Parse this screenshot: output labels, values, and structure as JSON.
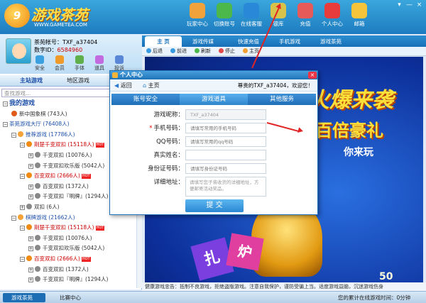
{
  "app": {
    "logo_badge": "9",
    "logo_text": "游戏茶苑",
    "logo_url": "WWW.GAMETEA.COM",
    "window_controls": [
      "▾",
      "—",
      "×"
    ],
    "top_buttons": [
      {
        "label": "玩家中心",
        "icon": "user-center-icon",
        "color": "#f2a23a"
      },
      {
        "label": "切换账号",
        "icon": "switch-account-icon",
        "color": "#4cb84c"
      },
      {
        "label": "在线客服",
        "icon": "support-icon",
        "color": "#2a88d8"
      },
      {
        "label": "银库",
        "icon": "bank-icon",
        "color": "#d8c34a"
      },
      {
        "label": "充值",
        "icon": "recharge-icon",
        "color": "#e65a5a"
      },
      {
        "label": "个人中心",
        "icon": "personal-center-icon",
        "color": "#e83c3c"
      },
      {
        "label": "邮箱",
        "icon": "mail-icon",
        "color": "#f6c43a"
      }
    ]
  },
  "user": {
    "account_label": "茶苑帐号：",
    "account": "TXF_a37404",
    "number_label": "数字ID：",
    "number": "6584960",
    "icons": [
      {
        "label": "安全",
        "icon": "shield-icon",
        "color": "#3aa0e0"
      },
      {
        "label": "会员",
        "icon": "vip-icon",
        "color": "#f09a2a"
      },
      {
        "label": "手体",
        "icon": "phone-icon",
        "color": "#5fb04a"
      },
      {
        "label": "道具",
        "icon": "props-icon",
        "color": "#c46ae0"
      },
      {
        "label": "投诉反馈",
        "icon": "feedback-icon",
        "color": "#5a86d8"
      }
    ]
  },
  "left_tabs": [
    "主站游戏",
    "地区游戏"
  ],
  "search": {
    "placeholder": "查找游戏..."
  },
  "tree": [
    {
      "text": "我的游戏",
      "level": 0,
      "type": "root",
      "color": "#1b4fa8",
      "bold": true
    },
    {
      "text": "新中国象棋 (743人)",
      "level": 1,
      "type": "game",
      "color": "#333"
    },
    {
      "text": "茶苑游戏大厅 (76408人)",
      "level": 0,
      "type": "root",
      "color": "#1b4fa8"
    },
    {
      "text": "推荐游戏 (17786人)",
      "level": 1,
      "type": "folder",
      "color": "#1b4fa8"
    },
    {
      "text": "荆楚千变双扣 (15118人)",
      "level": 2,
      "type": "hot",
      "color": "#c00",
      "badge": "HOT"
    },
    {
      "text": "千变双扣 (10076人)",
      "level": 3,
      "type": "room",
      "color": "#333"
    },
    {
      "text": "千变双扣欢乐版 (5042人)",
      "level": 3,
      "type": "room",
      "color": "#333"
    },
    {
      "text": "百变双扣 (2666人)",
      "level": 2,
      "type": "hot",
      "color": "#c00",
      "badge": "HOT"
    },
    {
      "text": "百变双扣 (1372人)",
      "level": 3,
      "type": "room",
      "color": "#333"
    },
    {
      "text": "千变双扣『明牌』(1294人)",
      "level": 3,
      "type": "room",
      "color": "#333"
    },
    {
      "text": "双扣 (6人)",
      "level": 2,
      "type": "room",
      "color": "#333"
    },
    {
      "text": "棋牌游戏 (21662人)",
      "level": 1,
      "type": "folder",
      "color": "#1b4fa8"
    },
    {
      "text": "荆楚千变双扣 (15118人)",
      "level": 2,
      "type": "hot",
      "color": "#c00",
      "badge": "HOT"
    },
    {
      "text": "千变双扣 (10076人)",
      "level": 3,
      "type": "room",
      "color": "#333"
    },
    {
      "text": "千变双扣欢乐版 (5042人)",
      "level": 3,
      "type": "room",
      "color": "#333"
    },
    {
      "text": "百变双扣 (2666人)",
      "level": 2,
      "type": "hot",
      "color": "#c00",
      "badge": "HOT"
    },
    {
      "text": "百变双扣 (1372人)",
      "level": 3,
      "type": "room",
      "color": "#333"
    },
    {
      "text": "千变双扣『明牌』(1294人)",
      "level": 3,
      "type": "room",
      "color": "#333"
    }
  ],
  "nav_tabs": [
    "主 页",
    "游戏传媒",
    "快速充值",
    "手机游戏",
    "游戏茶苑"
  ],
  "toolbar": [
    "后退",
    "前进",
    "刷新",
    "停止",
    "主页"
  ],
  "banner": {
    "line1": "火爆来袭",
    "line2": "百倍豪礼",
    "line3": "你来玩",
    "cardA": "扎",
    "cardB": "炉",
    "num": "50"
  },
  "notice": "健康游戏忠告：抵制不良游戏，拒绝盗版游戏。注意自我保护，谨防受骗上当。适度游戏益脑，沉迷游戏伤身",
  "status": {
    "left_app": "游戏茶苑",
    "left_tab": "比赛中心",
    "online": "您的累计在线游戏时间：0分钟"
  },
  "dialog": {
    "title": "个人中心",
    "close": "×",
    "back": "返回",
    "home": "主页",
    "welcome": "尊贵的TXF_a37404，欢迎您！",
    "tabs": [
      "账号安全",
      "游戏道具",
      "其他服务"
    ],
    "fields": [
      {
        "label": "游戏昵称：",
        "required": false,
        "value": "TXF_a37404",
        "placeholder": "",
        "readonly": true
      },
      {
        "label": "手机号码：",
        "required": true,
        "value": "",
        "placeholder": "请填写常用的手机号码",
        "readonly": false
      },
      {
        "label": "QQ号码：",
        "required": false,
        "value": "",
        "placeholder": "请填写常用的qq号码",
        "readonly": false
      },
      {
        "label": "真实姓名：",
        "required": false,
        "value": "",
        "placeholder": "",
        "readonly": false
      },
      {
        "label": "身份证号码：",
        "required": false,
        "value": "",
        "placeholder": "请填写身份证号码",
        "readonly": false
      }
    ],
    "address_label": "详细地址：",
    "address_placeholder": "请填写您子将收货的详细地址，方便邮寄活动奖品。",
    "submit": "提 交"
  }
}
